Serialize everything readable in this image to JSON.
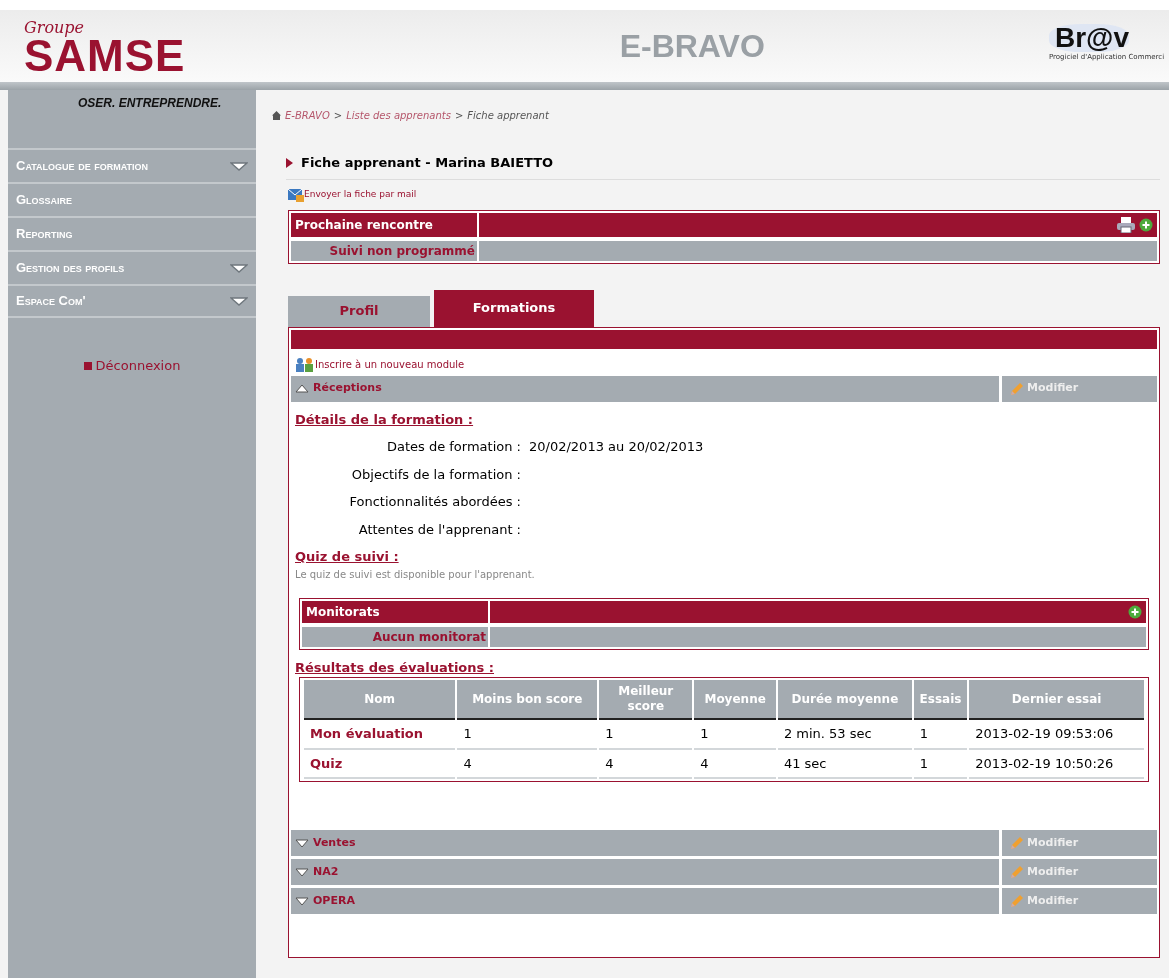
{
  "header": {
    "group_label": "Groupe",
    "brand": "SAMSE",
    "slogan": "OSER. ENTREPRENDRE.",
    "app_title": "E-BRAVO",
    "partner_logo": "Br@v",
    "partner_tagline": "Progiciel d'Application Commerci"
  },
  "sidebar": {
    "items": [
      {
        "label": "Catalogue de formation",
        "has_submenu": true
      },
      {
        "label": "Glossaire",
        "has_submenu": false
      },
      {
        "label": "Reporting",
        "has_submenu": false
      },
      {
        "label": "Gestion des profils",
        "has_submenu": true
      },
      {
        "label": "Espace Com'",
        "has_submenu": true
      }
    ],
    "logout": "Déconnexion"
  },
  "breadcrumb": [
    {
      "label": "E-BRAVO",
      "current": false
    },
    {
      "label": "Liste des apprenants",
      "current": false
    },
    {
      "label": "Fiche apprenant",
      "current": true
    }
  ],
  "breadcrumb_separator": ">",
  "page_title": "Fiche apprenant - Marina BAIETTO",
  "mail_link": "Envoyer la fiche par mail",
  "next_meeting": {
    "title": "Prochaine rencontre",
    "status": "Suivi non programmé"
  },
  "tabs": [
    {
      "label": "Profil",
      "selected": false
    },
    {
      "label": "Formations",
      "selected": true
    }
  ],
  "enroll_link": "Inscrire à un nouveau module",
  "modules": [
    {
      "name": "Réceptions",
      "expanded": true,
      "action": "Modifier",
      "details_heading": "Détails de la formation :",
      "fields": [
        {
          "label": "Dates de formation :",
          "value": "20/02/2013 au 20/02/2013"
        },
        {
          "label": "Objectifs de la formation :"
        },
        {
          "label": "Fonctionnalités abordées :"
        },
        {
          "label": "Attentes de l'apprenant :"
        }
      ],
      "quiz_heading": "Quiz de suivi :",
      "quiz_text": "Le quiz de suivi est disponible pour l'apprenant.",
      "monitorats": {
        "title": "Monitorats",
        "empty": "Aucun monitorat"
      },
      "results_heading": "Résultats des évaluations :",
      "results": {
        "columns": [
          "Nom",
          "Moins bon score",
          "Meilleur score",
          "Moyenne",
          "Durée moyenne",
          "Essais",
          "Dernier essai"
        ],
        "rows": [
          [
            "Mon évaluation",
            "1",
            "1",
            "1",
            "2 min. 53 sec",
            "1",
            "2013-02-19 09:53:06"
          ],
          [
            "Quiz",
            "4",
            "4",
            "4",
            "41 sec",
            "1",
            "2013-02-19 10:50:26"
          ]
        ]
      }
    },
    {
      "name": "Ventes",
      "expanded": false,
      "action": "Modifier"
    },
    {
      "name": "NA2",
      "expanded": false,
      "action": "Modifier"
    },
    {
      "name": "OPERA",
      "expanded": false,
      "action": "Modifier"
    }
  ]
}
